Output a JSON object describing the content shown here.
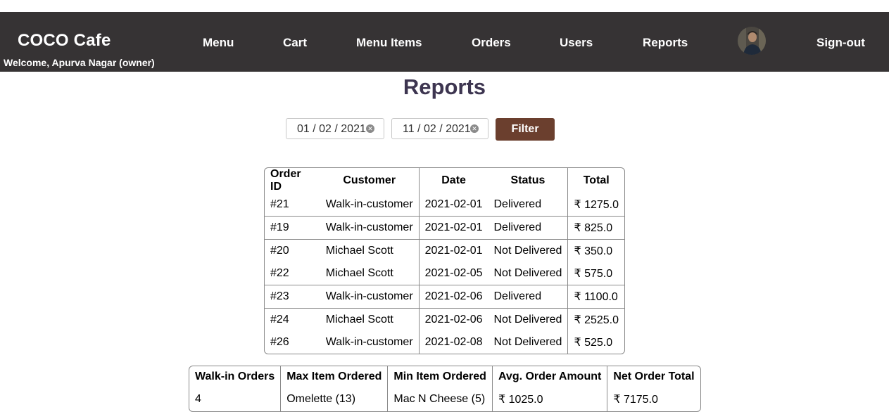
{
  "header": {
    "brand": "COCO Cafe",
    "welcome": "Welcome, Apurva Nagar (owner)",
    "nav": [
      "Menu",
      "Cart",
      "Menu Items",
      "Orders",
      "Users",
      "Reports"
    ],
    "signout": "Sign-out",
    "avatar_icon": "user-avatar"
  },
  "page": {
    "title": "Reports"
  },
  "filter": {
    "from_date": "01 / 02 / 2021",
    "to_date": "11 / 02 / 2021",
    "clear_icon": "clear-icon",
    "button": "Filter"
  },
  "orders_table": {
    "columns": [
      "Order ID",
      "Customer",
      "Date",
      "Status",
      "Total"
    ],
    "rows": [
      [
        "#21",
        "Walk-in-customer",
        "2021-02-01",
        "Delivered",
        "₹ 1275.0"
      ],
      [
        "#19",
        "Walk-in-customer",
        "2021-02-01",
        "Delivered",
        "₹ 825.0"
      ],
      [
        "#20",
        "Michael Scott",
        "2021-02-01",
        "Not Delivered",
        "₹ 350.0"
      ],
      [
        "#22",
        "Michael Scott",
        "2021-02-05",
        "Not Delivered",
        "₹ 575.0"
      ],
      [
        "#23",
        "Walk-in-customer",
        "2021-02-06",
        "Delivered",
        "₹ 1100.0"
      ],
      [
        "#24",
        "Michael Scott",
        "2021-02-06",
        "Not Delivered",
        "₹ 2525.0"
      ],
      [
        "#26",
        "Walk-in-customer",
        "2021-02-08",
        "Not Delivered",
        "₹ 525.0"
      ]
    ]
  },
  "summary_table": {
    "columns": [
      "Walk-in Orders",
      "Max Item Ordered",
      "Min Item Ordered",
      "Avg. Order Amount",
      "Net Order Total"
    ],
    "values": [
      "4",
      "Omelette (13)",
      "Mac N Cheese (5)",
      "₹ 1025.0",
      "₹ 7175.0"
    ]
  },
  "colors": {
    "navbar_bg": "#363334",
    "title_color": "#3d3550",
    "filter_button_bg": "#6b3f2e"
  }
}
